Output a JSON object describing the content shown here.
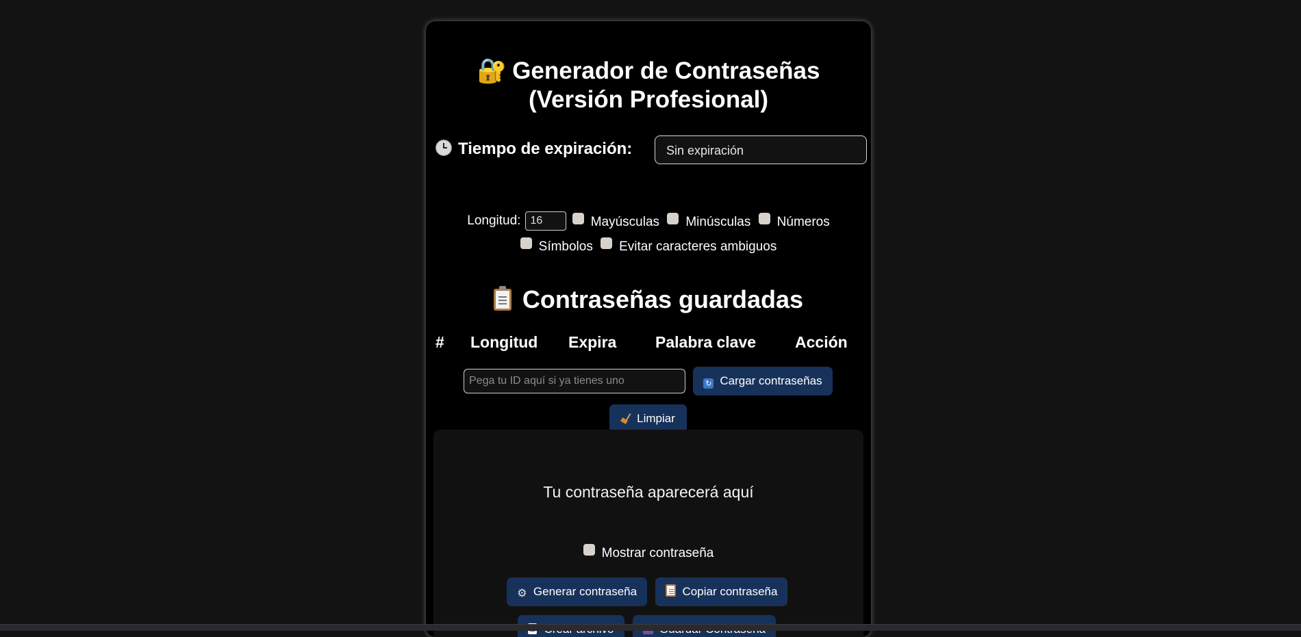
{
  "app": {
    "title_line1": "Generador de Contraseñas",
    "title_line2": "(Versión Profesional)",
    "lock_icon": "🔐"
  },
  "expiration": {
    "label": "Tiempo de expiración:",
    "icon": "clock-icon",
    "selected": "Sin expiración"
  },
  "options": {
    "length_label": "Longitud:",
    "length_value": "16",
    "uppercase": "Mayúsculas",
    "lowercase": "Minúsculas",
    "numbers": "Números",
    "symbols": "Símbolos",
    "avoid_ambiguous": "Evitar caracteres ambiguos"
  },
  "saved": {
    "title": "Contraseñas guardadas",
    "icon": "clipboard-icon",
    "columns": [
      "#",
      "Longitud",
      "Expira",
      "Palabra clave",
      "Acción"
    ],
    "id_placeholder": "Pega tu ID aquí si ya tienes uno",
    "load_button": "Cargar contraseñas",
    "clear_button": "Limpiar"
  },
  "generator": {
    "display_text": "Tu contraseña aparecerá aquí",
    "show_password": "Mostrar contraseña",
    "generate_button": "Generar contraseña",
    "copy_button": "Copiar contraseña",
    "create_file_button": "Crear archivo",
    "save_button": "Guardar Contraseña"
  },
  "colors": {
    "page_bg": "#131313",
    "card_bg": "#000000",
    "button_bg": "#17325a",
    "panel_bg": "#121111"
  }
}
